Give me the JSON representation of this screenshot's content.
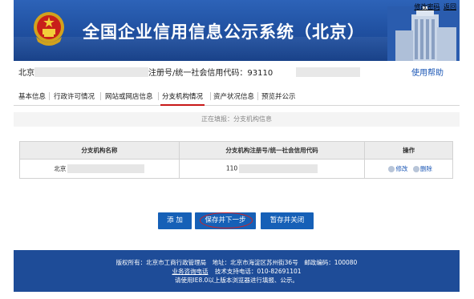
{
  "header": {
    "title": "全国企业信用信息公示系统（北京）",
    "links": [
      "修改密码",
      "返回"
    ]
  },
  "info": {
    "location": "北京",
    "reg_label": "注册号/统一社会信用代码：93110",
    "help": "使用帮助"
  },
  "tabs": [
    {
      "label": "基本信息"
    },
    {
      "label": "行政许可情况"
    },
    {
      "label": "网站或网店信息"
    },
    {
      "label": "分支机构情况",
      "active": true
    },
    {
      "label": "资产状况信息"
    },
    {
      "label": "预览并公示"
    }
  ],
  "status_text": "正在填报：分支机构信息",
  "table": {
    "headers": [
      "分支机构名称",
      "分支机构注册号/统一社会信用代码",
      "操作"
    ],
    "rows": [
      {
        "name": "北京",
        "reg": "110",
        "edit": "修改",
        "delete": "删除"
      }
    ]
  },
  "buttons": {
    "add": "添 加",
    "save_next": "保存并下一步",
    "save_close": "暂存并关闭"
  },
  "footer": {
    "line1": "版权所有：北京市工商行政管理局　地址：北京市海淀区苏州街36号　邮政编码：100080",
    "consult": "业务咨询电话",
    "tech": "技术支持电话：010-82691101",
    "line3": "请使用IE8.0以上版本浏览器进行填报、公示。"
  },
  "colors": {
    "header_blue": "#1f4f9f",
    "button_blue": "#1660b7",
    "active_tab_underline": "#c81818",
    "highlight_circle": "#d42020"
  }
}
